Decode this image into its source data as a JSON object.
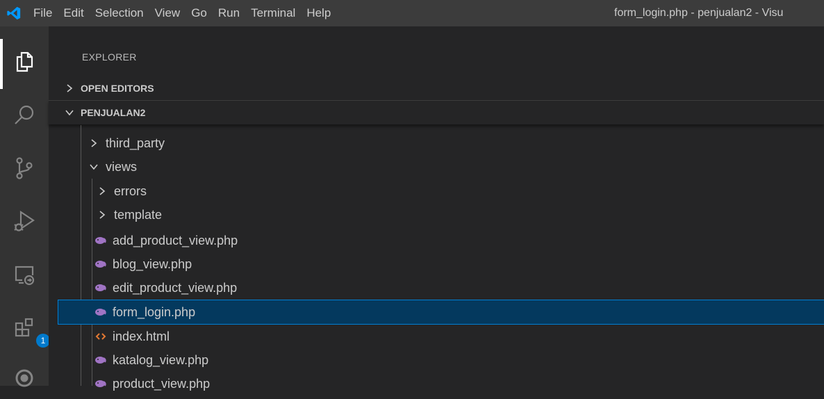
{
  "menu": [
    "File",
    "Edit",
    "Selection",
    "View",
    "Go",
    "Run",
    "Terminal",
    "Help"
  ],
  "window_title": "form_login.php - penjualan2 - Visu",
  "explorer": {
    "title": "EXPLORER",
    "open_editors": "OPEN EDITORS",
    "project": "PENJUALAN2"
  },
  "extensions_badge": "1",
  "tree": {
    "third_party": "third_party",
    "views": "views",
    "errors": "errors",
    "template": "template",
    "add_product_view": "add_product_view.php",
    "blog_view": "blog_view.php",
    "edit_product_view": "edit_product_view.php",
    "form_login": "form_login.php",
    "index_html": "index.html",
    "katalog_view": "katalog_view.php",
    "product_view": "product_view.php"
  },
  "colors": {
    "accent": "#007acc",
    "selection_bg": "#04395e",
    "php_icon": "#a074c4",
    "html_icon": "#e37933"
  },
  "icons": [
    "vscode-logo-icon",
    "files-icon",
    "search-icon",
    "source-control-icon",
    "run-debug-icon",
    "remote-explorer-icon",
    "extensions-icon",
    "account-icon",
    "chevron-right-icon",
    "chevron-down-icon",
    "php-file-icon",
    "html-file-icon"
  ]
}
